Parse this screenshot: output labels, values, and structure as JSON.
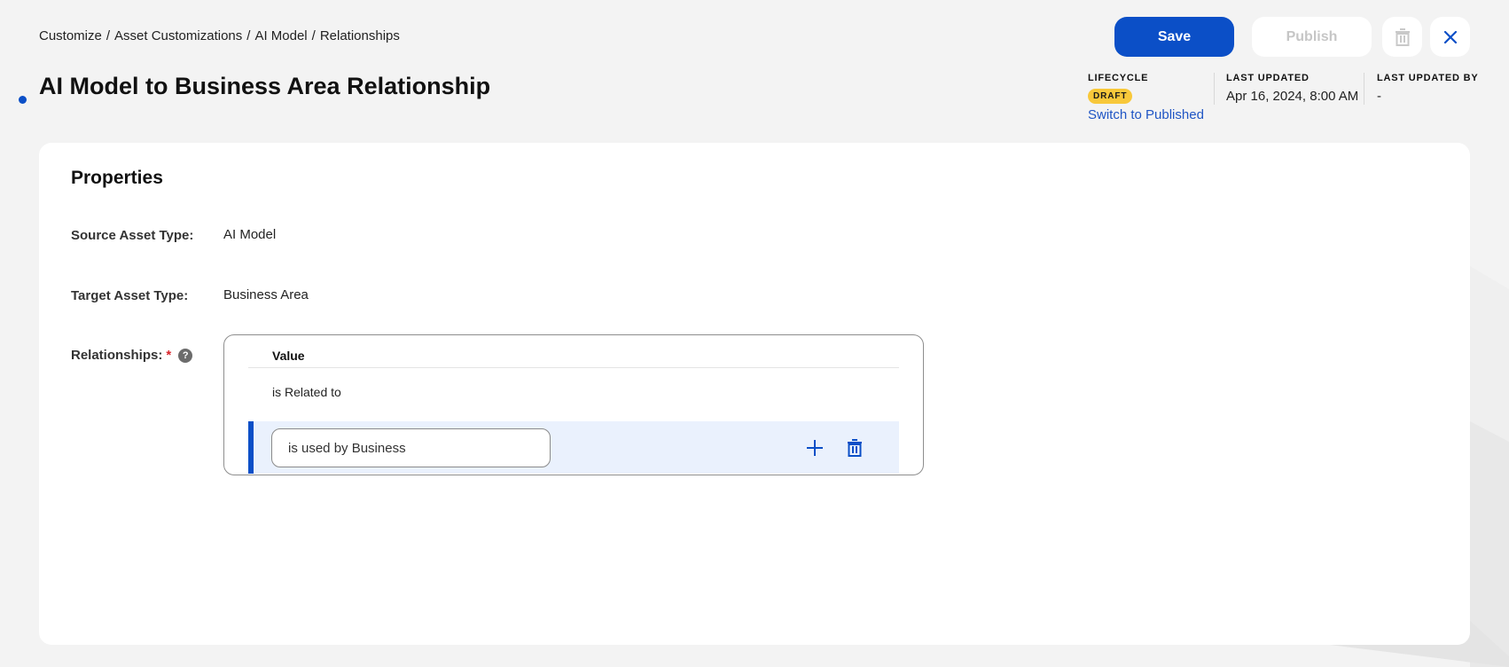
{
  "breadcrumb": [
    "Customize",
    "Asset Customizations",
    "AI Model",
    "Relationships"
  ],
  "breadcrumb_separator": "/",
  "page_title": "AI Model to Business Area Relationship",
  "toolbar": {
    "save_label": "Save",
    "publish_label": "Publish",
    "delete_icon": "trash-icon",
    "close_icon": "close-icon"
  },
  "meta": {
    "lifecycle_label": "LIFECYCLE",
    "lifecycle_badge": "DRAFT",
    "switch_link": "Switch to Published",
    "last_updated_label": "LAST UPDATED",
    "last_updated_value": "Apr 16, 2024, 8:00 AM",
    "last_updated_by_label": "LAST UPDATED BY",
    "last_updated_by_value": "-"
  },
  "colors": {
    "accent": "#0b4fc7",
    "badge_draft": "#f8c83a",
    "required": "#d9262c",
    "edit_row_bg": "#eaf1fd"
  },
  "properties": {
    "title": "Properties",
    "source_label": "Source Asset Type:",
    "source_value": "AI Model",
    "target_label": "Target Asset Type:",
    "target_value": "Business Area",
    "relationships_label": "Relationships:",
    "required_mark": "*",
    "help_icon": "?",
    "table": {
      "column_header": "Value",
      "rows": [
        "is Related to"
      ],
      "edit_row_value": "is used by Business"
    }
  }
}
